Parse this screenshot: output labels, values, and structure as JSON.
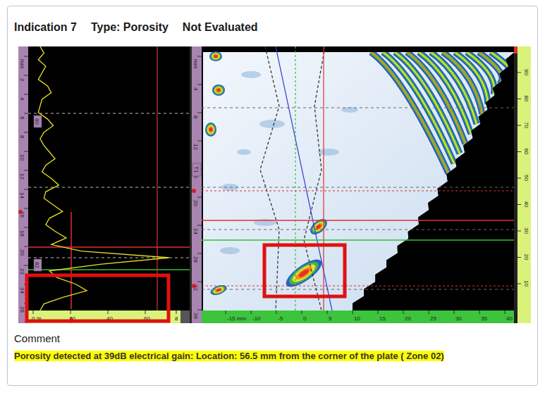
{
  "indication": {
    "title": "Indication 7",
    "type": "Type: Porosity",
    "status": "Not Evaluated"
  },
  "ascan": {
    "depth_ticks": [
      "mm",
      "2",
      "4",
      "6",
      "8",
      "10",
      "12",
      "14",
      "16",
      "18",
      "20",
      "22",
      "24",
      "26"
    ],
    "amplitude_ticks": [
      "0 %",
      "20",
      "40",
      "60",
      "8"
    ],
    "cursor_labels": [
      "80",
      "82"
    ],
    "waveform": [
      3,
      5,
      2,
      6,
      4,
      2,
      7,
      9,
      4,
      3,
      2,
      7,
      10,
      5,
      3,
      5,
      8,
      11,
      6,
      4,
      9,
      13,
      6,
      5,
      10,
      15,
      8,
      6,
      11,
      17,
      9,
      25,
      72,
      35,
      8,
      12,
      22,
      28,
      15,
      5,
      3
    ]
  },
  "sscan": {
    "depth_ticks": [
      "mm",
      "4",
      "8",
      "12",
      "16",
      "20",
      "24",
      "28",
      "32",
      "36"
    ],
    "cursor_label": "T1",
    "index_ticks": [
      "-15 mm",
      "-10",
      "-5",
      "0",
      "5",
      "10",
      "15",
      "20",
      "25",
      "30",
      "35",
      "40"
    ],
    "percent_ticks": [
      "90",
      "80",
      "70",
      "60",
      "50",
      "40",
      "30",
      "20",
      "10"
    ]
  },
  "comment": {
    "label": "Comment",
    "text": "Porosity detected at 39dB electrical gain: Location: 56.5 mm from the corner of the plate ( Zone 02)"
  }
}
